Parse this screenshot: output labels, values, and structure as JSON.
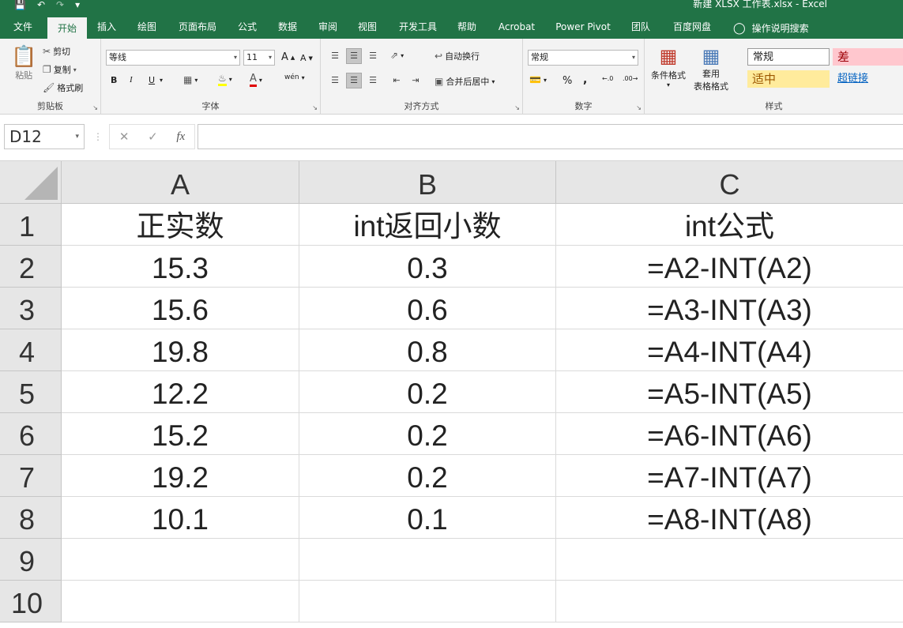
{
  "window": {
    "title": "新建 XLSX 工作表.xlsx  -  Excel"
  },
  "qat": {
    "save_icon": "save-icon",
    "undo_icon": "undo-icon",
    "redo_icon": "redo-icon",
    "customize_icon": "customize-icon"
  },
  "tabs": [
    {
      "label": "文件"
    },
    {
      "label": "开始"
    },
    {
      "label": "插入"
    },
    {
      "label": "绘图"
    },
    {
      "label": "页面布局"
    },
    {
      "label": "公式"
    },
    {
      "label": "数据"
    },
    {
      "label": "审阅"
    },
    {
      "label": "视图"
    },
    {
      "label": "开发工具"
    },
    {
      "label": "帮助"
    },
    {
      "label": "Acrobat"
    },
    {
      "label": "Power Pivot"
    },
    {
      "label": "团队"
    },
    {
      "label": "百度网盘"
    }
  ],
  "tell_me": "操作说明搜索",
  "ribbon": {
    "clipboard": {
      "label": "剪贴板",
      "paste": "粘贴",
      "cut": "剪切",
      "copy": "复制",
      "format_painter": "格式刷"
    },
    "font": {
      "label": "字体",
      "name": "等线",
      "size": "11",
      "bold": "B",
      "italic": "I",
      "underline": "U",
      "wen": "wén"
    },
    "alignment": {
      "label": "对齐方式",
      "wrap": "自动换行",
      "merge": "合并后居中"
    },
    "number": {
      "label": "数字",
      "format": "常规",
      "percent": "%",
      "comma": ","
    },
    "styles": {
      "label": "样式",
      "conditional": "条件格式",
      "table_format_1": "套用",
      "table_format_2": "表格格式",
      "normal": "常规",
      "bad": "差",
      "neutral": "适中",
      "hyperlink": "超链接"
    }
  },
  "formula_bar": {
    "name_box": "D12",
    "cancel": "✕",
    "enter": "✓",
    "fx": "fx",
    "value": ""
  },
  "columns": [
    "A",
    "B",
    "C"
  ],
  "rows": [
    {
      "num": "1",
      "a": "正实数",
      "b": "int返回小数",
      "c": "int公式"
    },
    {
      "num": "2",
      "a": "15.3",
      "b": "0.3",
      "c": "=A2-INT(A2)"
    },
    {
      "num": "3",
      "a": "15.6",
      "b": "0.6",
      "c": "=A3-INT(A3)"
    },
    {
      "num": "4",
      "a": "19.8",
      "b": "0.8",
      "c": "=A4-INT(A4)"
    },
    {
      "num": "5",
      "a": "12.2",
      "b": "0.2",
      "c": "=A5-INT(A5)"
    },
    {
      "num": "6",
      "a": "15.2",
      "b": "0.2",
      "c": "=A6-INT(A6)"
    },
    {
      "num": "7",
      "a": "19.2",
      "b": "0.2",
      "c": "=A7-INT(A7)"
    },
    {
      "num": "8",
      "a": "10.1",
      "b": "0.1",
      "c": "=A8-INT(A8)"
    },
    {
      "num": "9",
      "a": "",
      "b": "",
      "c": ""
    },
    {
      "num": "10",
      "a": "",
      "b": "",
      "c": ""
    }
  ],
  "colors": {
    "brand": "#217346",
    "bad_bg": "#ffc7ce",
    "bad_fg": "#9c0006",
    "neutral_bg": "#ffeb9c",
    "neutral_fg": "#9c5700",
    "hyperlink": "#0563c1"
  }
}
